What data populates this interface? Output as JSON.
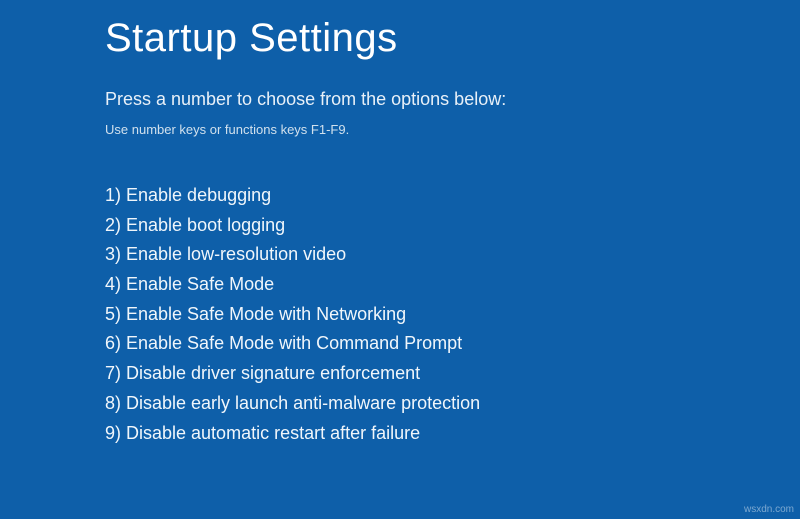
{
  "title": "Startup Settings",
  "subtitle": "Press a number to choose from the options below:",
  "hint": "Use number keys or functions keys F1-F9.",
  "options": [
    "1) Enable debugging",
    "2) Enable boot logging",
    "3) Enable low-resolution video",
    "4) Enable Safe Mode",
    "5) Enable Safe Mode with Networking",
    "6) Enable Safe Mode with Command Prompt",
    "7) Disable driver signature enforcement",
    "8) Disable early launch anti-malware protection",
    "9) Disable automatic restart after failure"
  ],
  "watermark": "wsxdn.com"
}
